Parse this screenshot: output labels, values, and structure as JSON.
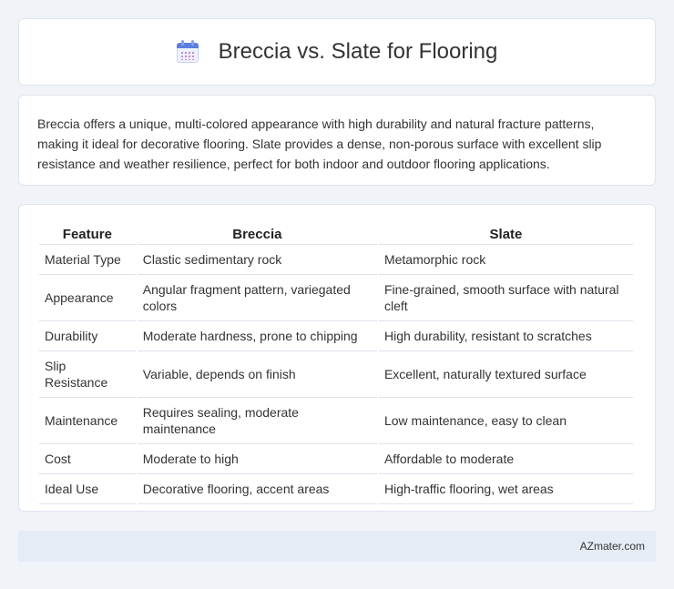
{
  "header": {
    "title": "Breccia vs. Slate for Flooring",
    "icon": "calendar-icon"
  },
  "intro": "Breccia offers a unique, multi-colored appearance with high durability and natural fracture patterns, making it ideal for decorative flooring. Slate provides a dense, non-porous surface with excellent slip resistance and weather resilience, perfect for both indoor and outdoor flooring applications.",
  "table": {
    "headers": [
      "Feature",
      "Breccia",
      "Slate"
    ],
    "rows": [
      [
        "Material Type",
        "Clastic sedimentary rock",
        "Metamorphic rock"
      ],
      [
        "Appearance",
        "Angular fragment pattern, variegated colors",
        "Fine-grained, smooth surface with natural cleft"
      ],
      [
        "Durability",
        "Moderate hardness, prone to chipping",
        "High durability, resistant to scratches"
      ],
      [
        "Slip Resistance",
        "Variable, depends on finish",
        "Excellent, naturally textured surface"
      ],
      [
        "Maintenance",
        "Requires sealing, moderate maintenance",
        "Low maintenance, easy to clean"
      ],
      [
        "Cost",
        "Moderate to high",
        "Affordable to moderate"
      ],
      [
        "Ideal Use",
        "Decorative flooring, accent areas",
        "High-traffic flooring, wet areas"
      ]
    ]
  },
  "footer": {
    "source": "AZmater.com"
  },
  "colors": {
    "background": "#f0f3f8",
    "card": "#ffffff",
    "footer": "#e6ecf6",
    "icon_accent": "#5b7fe0"
  }
}
